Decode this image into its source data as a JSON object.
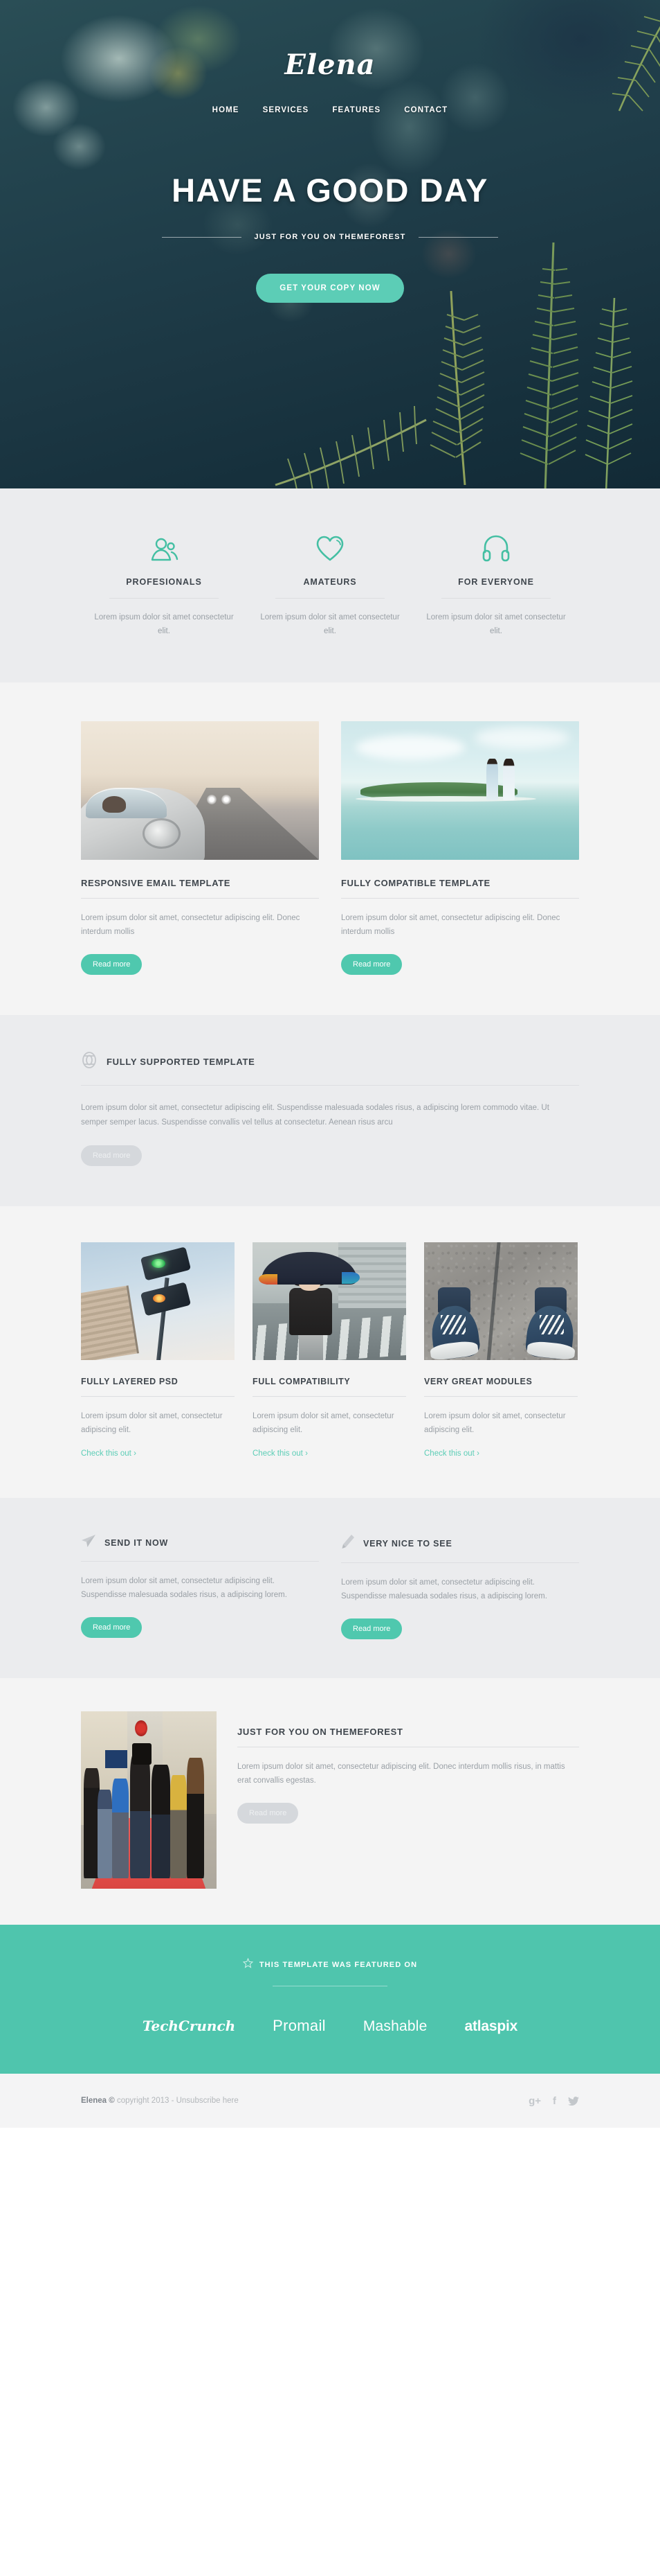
{
  "hero": {
    "logo": "Elena",
    "nav": [
      {
        "label": "HOME"
      },
      {
        "label": "SERVICES"
      },
      {
        "label": "FEATURES"
      },
      {
        "label": "CONTACT"
      }
    ],
    "title": "HAVE A GOOD DAY",
    "subtitle": "JUST FOR YOU ON THEMEFOREST",
    "cta_label": "GET YOUR COPY NOW"
  },
  "features": {
    "items": [
      {
        "icon": "users-icon",
        "title": "PROFESIONALS",
        "text": "Lorem ipsum dolor sit amet consectetur elit."
      },
      {
        "icon": "heart-icon",
        "title": "AMATEURS",
        "text": "Lorem ipsum dolor sit amet consectetur elit."
      },
      {
        "icon": "headphones-icon",
        "title": "FOR EVERYONE",
        "text": "Lorem ipsum dolor sit amet consectetur elit."
      }
    ]
  },
  "two_column": {
    "items": [
      {
        "image": "vintage-car-on-road-photo",
        "title": "RESPONSIVE EMAIL TEMPLATE",
        "text": "Lorem ipsum dolor sit amet, consectetur adipiscing elit. Donec interdum mollis",
        "button_label": "Read more"
      },
      {
        "image": "couple-on-island-photo",
        "title": "FULLY COMPATIBLE TEMPLATE",
        "text": "Lorem ipsum dolor sit amet, consectetur adipiscing elit. Donec interdum mollis",
        "button_label": "Read more"
      }
    ]
  },
  "supported": {
    "icon": "lifebuoy-icon",
    "title": "FULLY SUPPORTED TEMPLATE",
    "text": "Lorem ipsum dolor sit amet, consectetur adipiscing elit. Suspendisse malesuada sodales risus, a adipiscing lorem commodo vitae. Ut semper semper lacus. Suspendisse convallis vel tellus at consectetur. Aenean risus arcu",
    "button_label": "Read more"
  },
  "three_column": {
    "items": [
      {
        "image": "traffic-light-photo",
        "title": "FULLY LAYERED PSD",
        "text": "Lorem ipsum dolor sit amet, consectetur adipiscing elit.",
        "link_label": "Check this out  ›"
      },
      {
        "image": "umbrella-girl-photo",
        "title": "FULL COMPATIBILITY",
        "text": "Lorem ipsum dolor sit amet, consectetur adipiscing elit.",
        "link_label": "Check this out  ›"
      },
      {
        "image": "sneakers-photo",
        "title": "VERY GREAT MODULES",
        "text": "Lorem ipsum dolor sit amet, consectetur adipiscing elit.",
        "link_label": "Check this out  ›"
      }
    ]
  },
  "pair": {
    "items": [
      {
        "icon": "paper-plane-icon",
        "title": "SEND IT NOW",
        "text": "Lorem ipsum dolor sit amet, consectetur adipiscing elit. Suspendisse malesuada sodales risus, a adipiscing lorem.",
        "button_label": "Read more"
      },
      {
        "icon": "pencil-icon",
        "title": "VERY NICE TO SEE",
        "text": "Lorem ipsum dolor sit amet, consectetur adipiscing elit. Suspendisse malesuada sodales risus, a adipiscing lorem.",
        "button_label": "Read more"
      }
    ]
  },
  "wide_feature": {
    "image": "red-carpet-photographers-photo",
    "title": "JUST FOR YOU ON THEMEFOREST",
    "text": "Lorem ipsum dolor sit amet, consectetur adipiscing elit. Donec interdum mollis risus, in mattis erat convallis egestas.",
    "button_label": "Read more"
  },
  "featured_band": {
    "icon": "star-icon",
    "title": "THIS TEMPLATE WAS FEATURED ON",
    "brands": [
      {
        "name": "TechCrunch"
      },
      {
        "name": "Promail"
      },
      {
        "name": "Mashable"
      },
      {
        "name": "atlaspix"
      }
    ]
  },
  "footer": {
    "brand": "Elenea ©",
    "copyright": " copyright 2013 - Unsubscribe here",
    "socials": [
      {
        "icon": "google-plus-icon",
        "glyph": "g+"
      },
      {
        "icon": "facebook-icon",
        "glyph": "f"
      },
      {
        "icon": "twitter-icon",
        "glyph": "ᴠ"
      }
    ]
  },
  "colors": {
    "accent_teal": "#4fc8ae",
    "hero_cta": "#5ccdb6",
    "band": "#4fc5ad",
    "heading": "#3f464d",
    "body_text": "#9aa0a6",
    "muted_button": "#d5d8dc"
  }
}
